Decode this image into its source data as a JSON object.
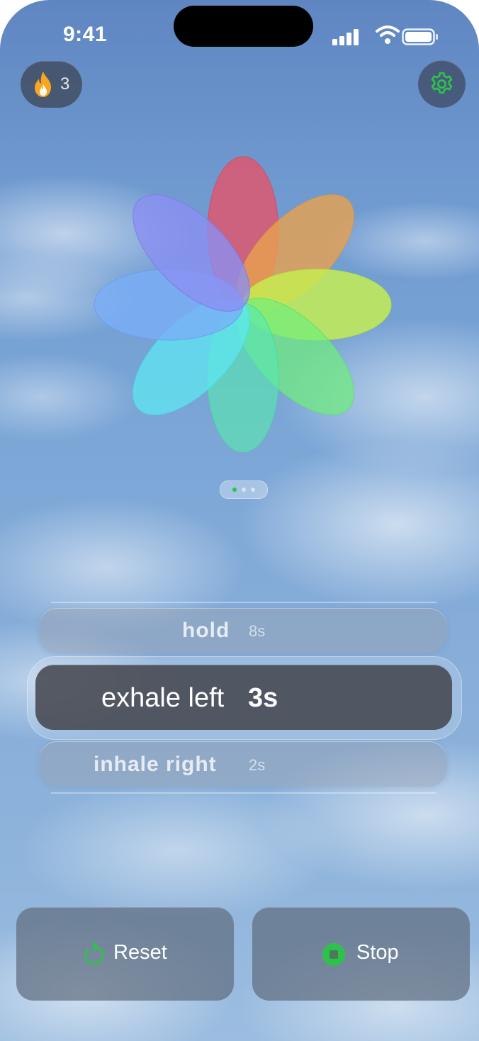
{
  "status_bar": {
    "time": "9:41"
  },
  "streak": {
    "count": "3",
    "icon": "flame-icon",
    "icon_color": "#f5a623"
  },
  "settings": {
    "icon": "gear-icon",
    "icon_color": "#2fc24b"
  },
  "flower": {
    "petal_colors": [
      "#e2566b",
      "#e8a14f",
      "#c6ef4f",
      "#6ff07a",
      "#59e9b0",
      "#5de9f2",
      "#7aaef7",
      "#8b8ff2"
    ]
  },
  "page_indicator": {
    "count": 3,
    "active_index": 0,
    "active_color": "#2fc24b"
  },
  "breath_steps": {
    "previous": {
      "label": "hold",
      "duration": "8s"
    },
    "current": {
      "label": "exhale left",
      "duration": "3s"
    },
    "next": {
      "label": "inhale right",
      "duration": "2s"
    }
  },
  "actions": {
    "reset_label": "Reset",
    "reset_icon": "reset-icon",
    "stop_label": "Stop",
    "stop_icon": "stop-icon",
    "accent_color": "#2fc24b"
  }
}
